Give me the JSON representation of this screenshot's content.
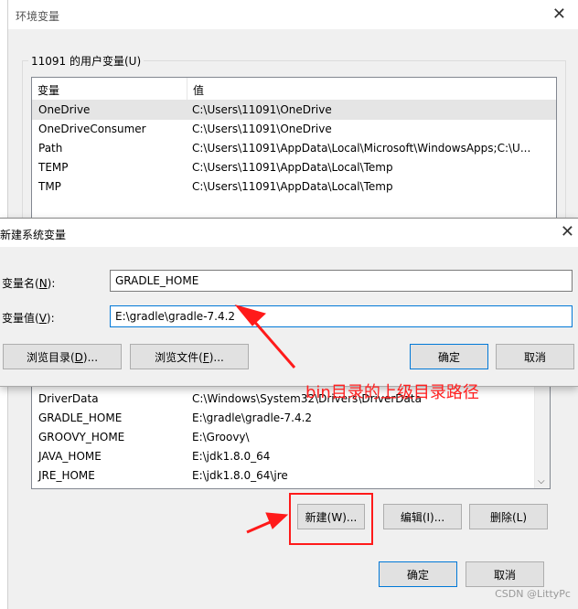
{
  "env_window": {
    "title": "环境变量",
    "close_glyph": "✕",
    "user_group_label": "11091 的用户变量(U)",
    "user_vars": {
      "headers": [
        "变量",
        "值"
      ],
      "rows": [
        {
          "name": "OneDrive",
          "value": "C:\\Users\\11091\\OneDrive",
          "selected": true
        },
        {
          "name": "OneDriveConsumer",
          "value": "C:\\Users\\11091\\OneDrive"
        },
        {
          "name": "Path",
          "value": "C:\\Users\\11091\\AppData\\Local\\Microsoft\\WindowsApps;C:\\U..."
        },
        {
          "name": "TEMP",
          "value": "C:\\Users\\11091\\AppData\\Local\\Temp"
        },
        {
          "name": "TMP",
          "value": "C:\\Users\\11091\\AppData\\Local\\Temp"
        }
      ]
    },
    "system_vars": {
      "rows": [
        {
          "name": "DriverData",
          "value": "C:\\Windows\\System32\\Drivers\\DriverData"
        },
        {
          "name": "GRADLE_HOME",
          "value": "E:\\gradle\\gradle-7.4.2"
        },
        {
          "name": "GROOVY_HOME",
          "value": "E:\\Groovy\\"
        },
        {
          "name": "JAVA_HOME",
          "value": "E:\\jdk1.8.0_64"
        },
        {
          "name": "JRE_HOME",
          "value": "E:\\jdk1.8.0_64\\jre"
        }
      ]
    },
    "buttons": {
      "new": "新建(W)...",
      "edit": "编辑(I)...",
      "delete": "删除(L)",
      "ok": "确定",
      "cancel": "取消"
    }
  },
  "new_var_dialog": {
    "title": "新建系统变量",
    "close_glyph": "✕",
    "name_label": "变量名(",
    "name_key": "N",
    "name_label_end": "):",
    "name_value": "GRADLE_HOME",
    "value_label": "变量值(",
    "value_key": "V",
    "value_label_end": "):",
    "value_value": "E:\\gradle\\gradle-7.4.2",
    "browse_dir_label": "浏览目录(",
    "browse_dir_key": "D",
    "browse_dir_end": ")...",
    "browse_file_label": "浏览文件(",
    "browse_file_key": "F",
    "browse_file_end": ")...",
    "ok": "确定",
    "cancel": "取消"
  },
  "annotation": {
    "text": "bin目录的上级目录路径",
    "color": "#ff2020"
  },
  "watermark": "CSDN @LittyPc"
}
